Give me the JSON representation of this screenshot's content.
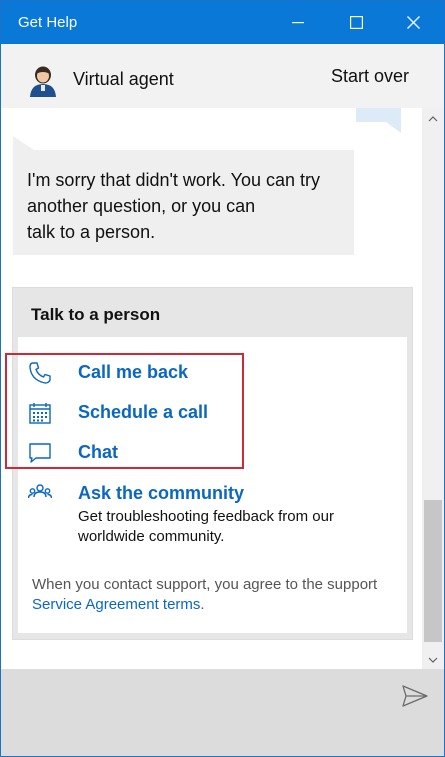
{
  "window": {
    "title": "Get Help"
  },
  "header": {
    "agent_name": "Virtual agent",
    "start_over": "Start over"
  },
  "chat": {
    "message_line1": "I'm sorry that didn't work. You can try",
    "message_line2": "another question, or you can",
    "message_line3": "talk to a person."
  },
  "card": {
    "title": "Talk to a person",
    "options": [
      {
        "label": "Call me back",
        "icon": "phone-icon"
      },
      {
        "label": "Schedule a call",
        "icon": "calendar-icon"
      },
      {
        "label": "Chat",
        "icon": "chat-bubble-icon"
      },
      {
        "label": "Ask the community",
        "icon": "community-icon"
      }
    ],
    "community_desc": "Get troubleshooting feedback from our worldwide community.",
    "legal_prefix": "When you contact support, you agree to the support ",
    "legal_link": "Service Agreement terms",
    "legal_suffix": "."
  },
  "colors": {
    "titlebar": "#0a78d7",
    "link": "#0a67c2",
    "highlight": "#cc2a36"
  }
}
